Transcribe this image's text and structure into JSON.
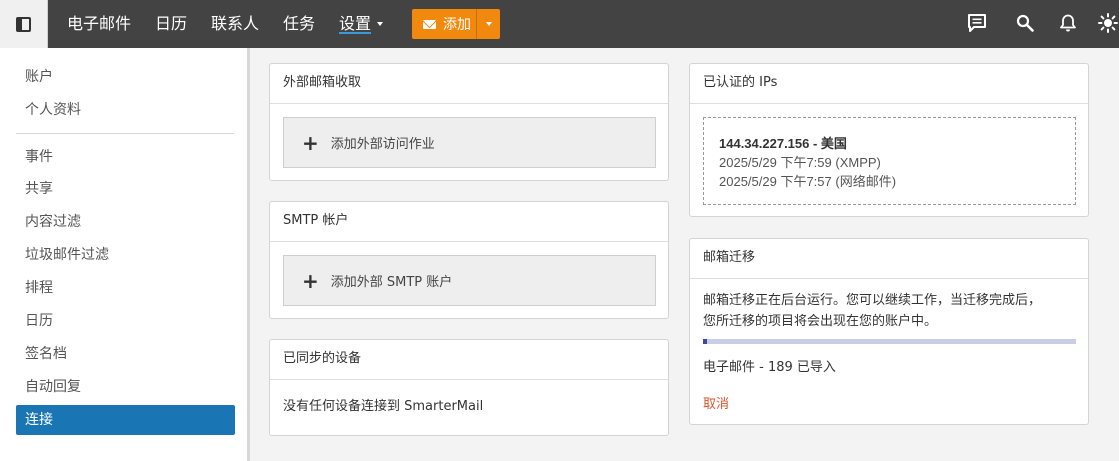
{
  "nav": {
    "items": [
      {
        "label": "电子邮件"
      },
      {
        "label": "日历"
      },
      {
        "label": "联系人"
      },
      {
        "label": "任务"
      },
      {
        "label": "设置"
      }
    ],
    "add_button": {
      "label": "添加"
    },
    "icons": [
      "chat-icon",
      "search-icon",
      "bell-icon",
      "sun-icon"
    ]
  },
  "sidebar": {
    "items": [
      {
        "label": "账户"
      },
      {
        "label": "个人资料"
      },
      {
        "label": "事件"
      },
      {
        "label": "共享"
      },
      {
        "label": "内容过滤"
      },
      {
        "label": "垃圾邮件过滤"
      },
      {
        "label": "排程"
      },
      {
        "label": "日历"
      },
      {
        "label": "签名档"
      },
      {
        "label": "自动回复"
      },
      {
        "label": "连接"
      }
    ],
    "active_index": 10
  },
  "external_mail": {
    "title": "外部邮箱收取",
    "add_label": "添加外部访问作业"
  },
  "smtp": {
    "title": "SMTP 帐户",
    "add_label": "添加外部 SMTP 账户"
  },
  "synced_devices": {
    "title": "已同步的设备",
    "empty_text": "没有任何设备连接到 SmarterMail"
  },
  "authenticated_ips": {
    "title": "已认证的 IPs",
    "entry": {
      "heading": "144.34.227.156 - 美国",
      "lines": [
        "2025/5/29 下午7:59 (XMPP)",
        "2025/5/29 下午7:57 (网络邮件)"
      ]
    }
  },
  "migration": {
    "title": "邮箱迁移",
    "description_line1": "邮箱迁移正在后台运行。您可以继续工作，当迁移完成后，",
    "description_line2": "您所迁移的项目将会出现在您的账户中。",
    "progress_fraction": 0.01,
    "status": "电子邮件 - 189 已导入",
    "cancel_label": "取消"
  },
  "colors": {
    "topbar": "#434343",
    "accent_orange": "#f0890d",
    "active_blue": "#1a75b4",
    "cancel_red": "#d9542b"
  }
}
